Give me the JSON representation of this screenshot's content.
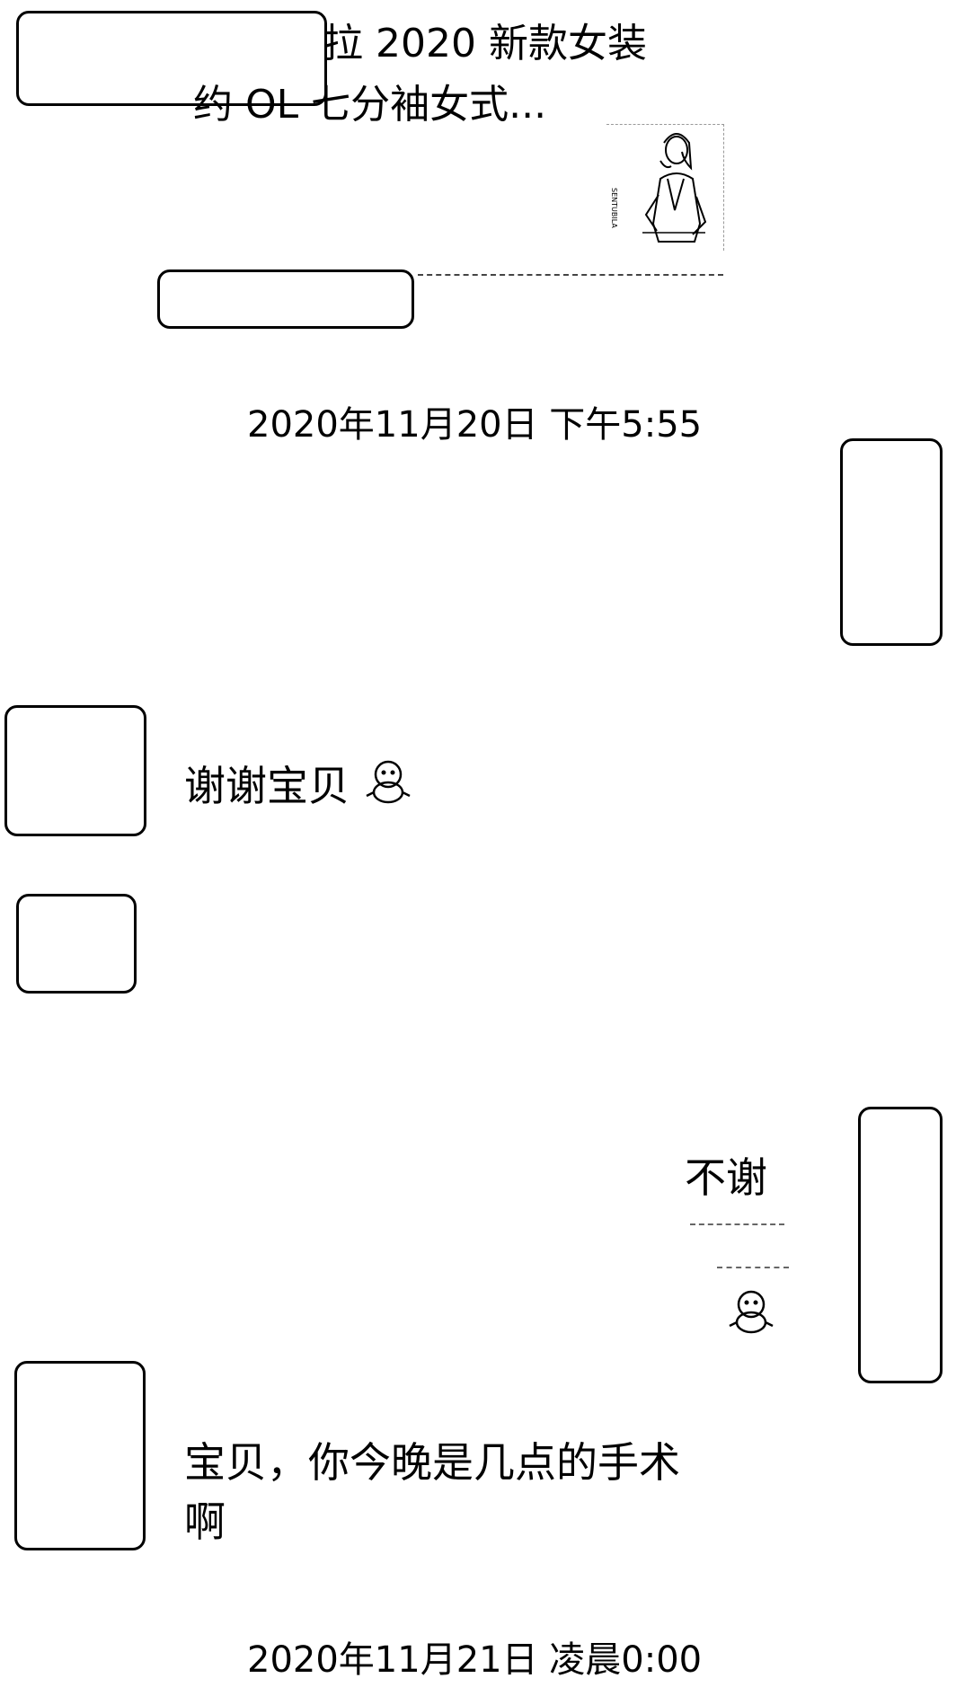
{
  "product_card": {
    "title_line_1": "拉 2020 新款女装",
    "title_line_2": "约 OL 七分袖女式...",
    "thumb_side_text": "SENTUBILA"
  },
  "conversation": [
    {
      "type": "timestamp",
      "text": "2020年11月20日 下午5:55"
    },
    {
      "type": "message",
      "side": "left",
      "text": "谢谢宝贝",
      "emoji": "qq-penguin-icon"
    },
    {
      "type": "message",
      "side": "right",
      "text": "不谢",
      "emoji": "qq-penguin-icon"
    },
    {
      "type": "message",
      "side": "left",
      "line_1": "宝贝，你今晚是几点的手术",
      "line_2": "啊"
    },
    {
      "type": "timestamp",
      "text": "2020年11月21日 凌晨0:00"
    }
  ],
  "colors": {
    "background": "#ffffff",
    "text": "#000000",
    "redaction_border": "#000000"
  }
}
